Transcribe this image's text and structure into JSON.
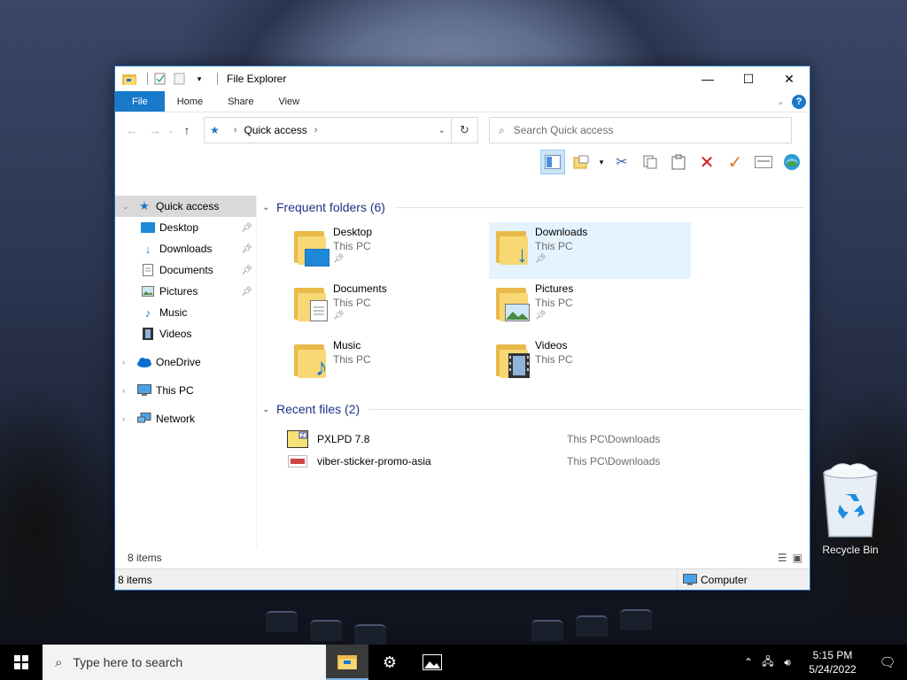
{
  "window": {
    "title": "File Explorer",
    "controls": {
      "minimize": "—",
      "maximize": "☐",
      "close": "✕"
    }
  },
  "ribbon": {
    "tabs": [
      "File",
      "Home",
      "Share",
      "View"
    ],
    "help": "?"
  },
  "address": {
    "location": "Quick access",
    "search_placeholder": "Search Quick access"
  },
  "nav": {
    "quick_access": "Quick access",
    "items": [
      {
        "label": "Desktop",
        "icon": "desktop-icon",
        "pinned": true
      },
      {
        "label": "Downloads",
        "icon": "downloads-icon",
        "pinned": true
      },
      {
        "label": "Documents",
        "icon": "documents-icon",
        "pinned": true
      },
      {
        "label": "Pictures",
        "icon": "pictures-icon",
        "pinned": true
      },
      {
        "label": "Music",
        "icon": "music-icon",
        "pinned": false
      },
      {
        "label": "Videos",
        "icon": "videos-icon",
        "pinned": false
      }
    ],
    "onedrive": "OneDrive",
    "thispc": "This PC",
    "network": "Network"
  },
  "frequent": {
    "header": "Frequent folders (6)",
    "folders": [
      {
        "name": "Desktop",
        "location": "This PC",
        "pinned": true
      },
      {
        "name": "Downloads",
        "location": "This PC",
        "pinned": true
      },
      {
        "name": "Documents",
        "location": "This PC",
        "pinned": true
      },
      {
        "name": "Pictures",
        "location": "This PC",
        "pinned": true
      },
      {
        "name": "Music",
        "location": "This PC",
        "pinned": false
      },
      {
        "name": "Videos",
        "location": "This PC",
        "pinned": false
      }
    ]
  },
  "recent": {
    "header": "Recent files (2)",
    "files": [
      {
        "name": "PXLPD 7.8",
        "path": "This PC\\Downloads"
      },
      {
        "name": "viber-sticker-promo-asia",
        "path": "This PC\\Downloads"
      }
    ]
  },
  "status": {
    "items_top": "8 items",
    "items_bottom": "8 items",
    "computer": "Computer"
  },
  "desktop": {
    "recycle_bin": "Recycle Bin"
  },
  "taskbar": {
    "search_placeholder": "Type here to search",
    "time": "5:15 PM",
    "date": "5/24/2022"
  }
}
